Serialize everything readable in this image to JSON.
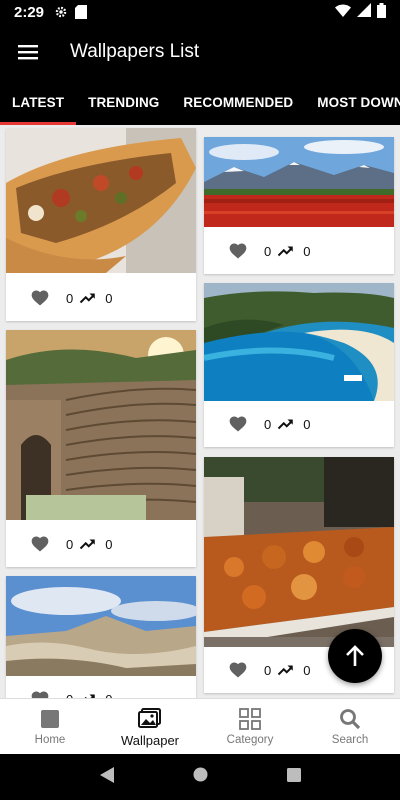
{
  "status_bar": {
    "time": "2:29"
  },
  "app_bar": {
    "title": "Wallpapers List"
  },
  "tabs": [
    {
      "label": "LATEST",
      "active": true
    },
    {
      "label": "TRENDING"
    },
    {
      "label": "RECOMMENDED"
    },
    {
      "label": "MOST DOWNLOADED"
    }
  ],
  "cards": [
    {
      "likes": "0",
      "views": "0"
    },
    {
      "likes": "0",
      "views": "0"
    },
    {
      "likes": "0",
      "views": "0"
    },
    {
      "likes": "0",
      "views": "0"
    },
    {
      "likes": "0",
      "views": "0"
    },
    {
      "likes": "0",
      "views": "0"
    }
  ],
  "bottom_nav": {
    "home": "Home",
    "wallpaper": "Wallpaper",
    "category": "Category",
    "search": "Search"
  },
  "colors": {
    "accent": "#e53935",
    "bar": "#000000"
  }
}
